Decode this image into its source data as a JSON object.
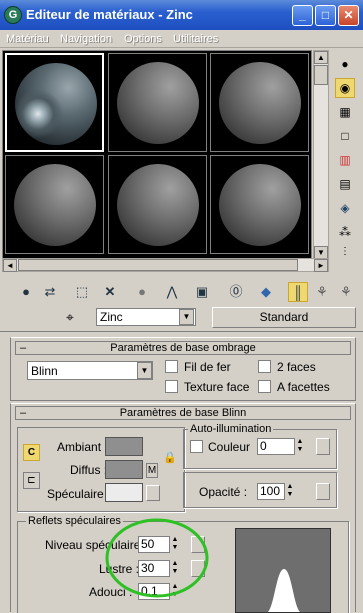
{
  "window": {
    "title": "Editeur de matériaux - Zinc",
    "app_icon": "G",
    "minimize": "_",
    "maximize": "□",
    "close": "✕"
  },
  "menu": [
    "Matériau",
    "Navigation",
    "Options",
    "Utilitaires"
  ],
  "material_name": "Zinc",
  "material_type": "Standard",
  "shading_rollout": {
    "title": "Paramètres de base ombrage",
    "shader": "Blinn",
    "wire": "Fil de fer",
    "two_sided": "2 faces",
    "face_map": "Texture face",
    "faceted": "A facettes"
  },
  "blinn_rollout": {
    "title": "Paramètres de base Blinn",
    "ambient": "Ambiant :",
    "diffuse": "Diffus :",
    "specular": "Spéculaire :",
    "lock_letter": "M",
    "lock_letter_c": "C",
    "self_illum": "Auto-illumination",
    "color": "Couleur",
    "color_value": "0",
    "opacity": "Opacité :",
    "opacity_value": "100"
  },
  "specular_highlights": {
    "title": "Reflets spéculaires",
    "level_label": "Niveau spéculaire :",
    "level_value": "50",
    "gloss_label": "Lustre :",
    "gloss_value": "30",
    "soften_label": "Adouci :",
    "soften_value": "0,1"
  },
  "annotation_color": "#2fc025"
}
